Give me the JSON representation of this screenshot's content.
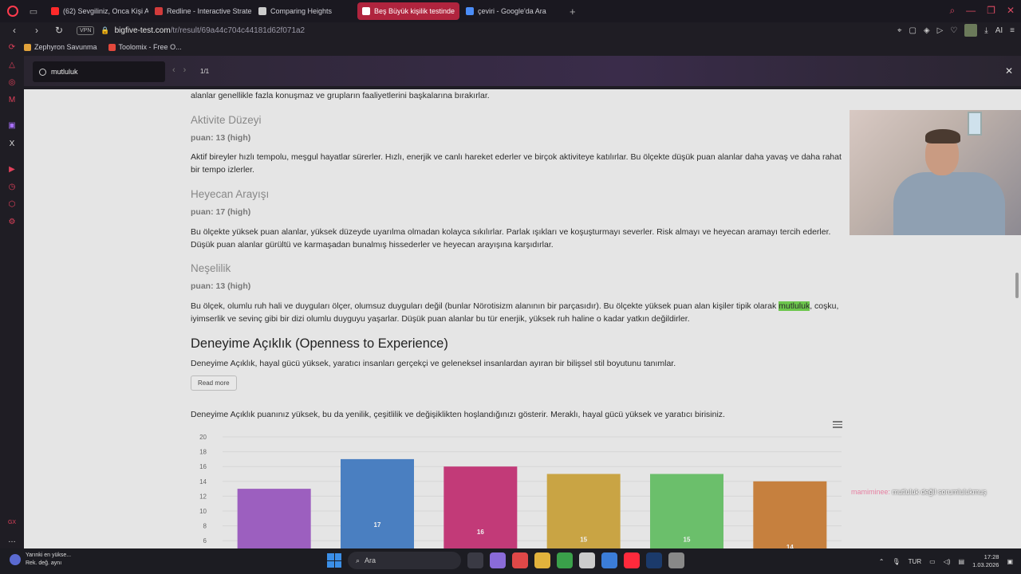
{
  "tabs": [
    {
      "title": "(62) Sevgiliniz, Onca Kişi A",
      "color": "#ff2a2a"
    },
    {
      "title": "Redline - Interactive Strate",
      "color": "#d23b3b"
    },
    {
      "title": "Comparing Heights",
      "color": "#cccccc"
    },
    {
      "title": "Beş Büyük kişilik testinde",
      "color": "#ffffff"
    },
    {
      "title": "çeviri - Google'da Ara",
      "color": "#4b8df8"
    }
  ],
  "address": {
    "vpn": "VPN",
    "host": "bigfive-test.com",
    "path": "/tr/result/69a44c704c44181d62f071a2"
  },
  "bookmarks": [
    {
      "label": "Zephyron Savunma",
      "color": "#e1a23b"
    },
    {
      "label": "Toolomix - Free O...",
      "color": "#e2483c"
    }
  ],
  "find": {
    "query": "mutluluk",
    "count": "1/1"
  },
  "content": {
    "intro_tail": "alanlar genellikle fazla konuşmaz ve grupların faaliyetlerini başkalarına bırakırlar.",
    "sections": [
      {
        "title": "Aktivite Düzeyi",
        "score": "puan: 13 (high)",
        "text": "Aktif bireyler hızlı tempolu, meşgul hayatlar sürerler. Hızlı, enerjik ve canlı hareket ederler ve birçok aktiviteye katılırlar. Bu ölçekte düşük puan alanlar daha yavaş ve daha rahat bir tempo izlerler."
      },
      {
        "title": "Heyecan Arayışı",
        "score": "puan: 17 (high)",
        "text": "Bu ölçekte yüksek puan alanlar, yüksek düzeyde uyarılma olmadan kolayca sıkılırlar. Parlak ışıkları ve koşuşturmayı severler. Risk almayı ve heyecan aramayı tercih ederler. Düşük puan alanlar gürültü ve karmaşadan bunalmış hissederler ve heyecan arayışına karşıdırlar."
      },
      {
        "title": "Neşelilik",
        "score": "puan: 13 (high)",
        "text_before": "Bu ölçek, olumlu ruh hali ve duyguları ölçer, olumsuz duyguları değil (bunlar Nörotisizm alanının bir parçasıdır). Bu ölçekte yüksek puan alan kişiler tipik olarak ",
        "highlight": "mutluluk",
        "text_after": ", coşku, iyimserlik ve sevinç gibi bir dizi olumlu duyguyu yaşarlar. Düşük puan alanlar bu tür enerjik, yüksek ruh haline o kadar yatkın değildirler."
      }
    ],
    "openness": {
      "title": "Deneyime Açıklık (Openness to Experience)",
      "desc": "Deneyime Açıklık, hayal gücü yüksek, yaratıcı insanları gerçekçi ve geleneksel insanlardan ayıran bir bilişsel stil boyutunu tanımlar.",
      "read_more": "Read more",
      "result": "Deneyime Açıklık puanınız yüksek, bu da yenilik, çeşitlilik ve değişiklikten hoşlandığınızı gösterir. Meraklı, hayal gücü yüksek ve yaratıcı birisiniz."
    }
  },
  "chart_data": {
    "type": "bar",
    "title": "",
    "xlabel": "",
    "ylabel": "",
    "categories": [
      "",
      "",
      "",
      "",
      "",
      ""
    ],
    "values": [
      13,
      17,
      16,
      15,
      15,
      14
    ],
    "colors": [
      "#9c5fbf",
      "#4a7fc1",
      "#c23a78",
      "#c9a444",
      "#6bbf6b",
      "#c6803e"
    ],
    "y_ticks_visible": [
      6,
      8,
      10,
      12,
      14,
      16,
      18,
      20
    ],
    "ylim": [
      0,
      20
    ],
    "grid": true
  },
  "stream": {
    "chat_user": "mamiminee:",
    "chat_msg": "mutluluk değil sorumlulukmuş"
  },
  "taskbar": {
    "weather_line1": "Yarınki en yükse...",
    "weather_line2": "Rek. değ. aynı",
    "search_placeholder": "Ara",
    "lang": "TUR",
    "time": "17:28",
    "date": "1.03.2026",
    "apps": [
      "#3a3a44",
      "#8a6bd8",
      "#e04848",
      "#e2b23c",
      "#3aa04a",
      "#ccc",
      "#3b7dd8",
      "#ff2a3c",
      "#1b3a6b",
      "#888"
    ]
  }
}
